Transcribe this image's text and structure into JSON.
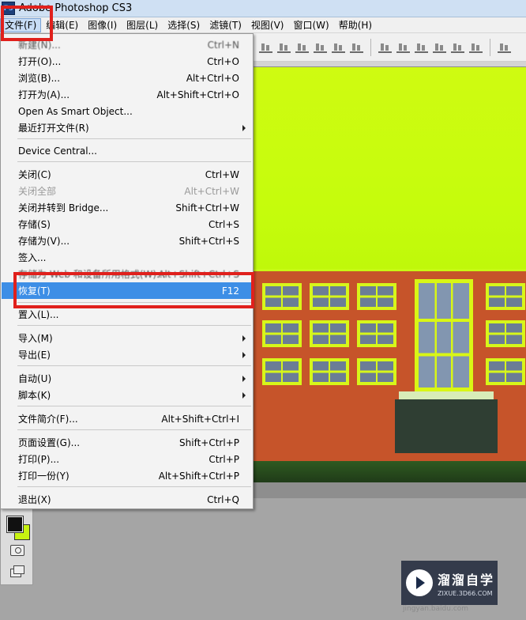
{
  "window": {
    "app_icon": "Ps",
    "title": "Adobe Photoshop CS3"
  },
  "menubar": [
    {
      "label": "文件(F)",
      "active": true
    },
    {
      "label": "编辑(E)"
    },
    {
      "label": "图像(I)"
    },
    {
      "label": "图层(L)"
    },
    {
      "label": "选择(S)"
    },
    {
      "label": "滤镜(T)"
    },
    {
      "label": "视图(V)"
    },
    {
      "label": "窗口(W)"
    },
    {
      "label": "帮助(H)"
    }
  ],
  "file_menu": {
    "items": [
      {
        "label": "新建(N)...",
        "shortcut": "Ctrl+N"
      },
      {
        "label": "打开(O)...",
        "shortcut": "Ctrl+O"
      },
      {
        "label": "浏览(B)...",
        "shortcut": "Alt+Ctrl+O"
      },
      {
        "label": "打开为(A)...",
        "shortcut": "Alt+Shift+Ctrl+O"
      },
      {
        "label": "Open As Smart Object...",
        "shortcut": ""
      },
      {
        "label": "最近打开文件(R)",
        "shortcut": "",
        "submenu": true
      },
      {
        "label": "Device Central...",
        "shortcut": ""
      },
      {
        "label": "关闭(C)",
        "shortcut": "Ctrl+W"
      },
      {
        "label": "关闭全部",
        "shortcut": "Alt+Ctrl+W",
        "disabled": true
      },
      {
        "label": "关闭并转到 Bridge...",
        "shortcut": "Shift+Ctrl+W"
      },
      {
        "label": "存储(S)",
        "shortcut": "Ctrl+S"
      },
      {
        "label": "存储为(V)...",
        "shortcut": "Shift+Ctrl+S"
      },
      {
        "label": "签入...",
        "shortcut": ""
      },
      {
        "label": "存储为 Web 和设备所用格式(W)...",
        "shortcut": "Alt+Shift+Ctrl+S"
      },
      {
        "label": "恢复(T)",
        "shortcut": "F12",
        "highlighted": true
      },
      {
        "label": "置入(L)...",
        "shortcut": ""
      },
      {
        "label": "导入(M)",
        "shortcut": "",
        "submenu": true
      },
      {
        "label": "导出(E)",
        "shortcut": "",
        "submenu": true
      },
      {
        "label": "自动(U)",
        "shortcut": "",
        "submenu": true
      },
      {
        "label": "脚本(K)",
        "shortcut": "",
        "submenu": true
      },
      {
        "label": "文件简介(F)...",
        "shortcut": "Alt+Shift+Ctrl+I"
      },
      {
        "label": "页面设置(G)...",
        "shortcut": "Shift+Ctrl+P"
      },
      {
        "label": "打印(P)...",
        "shortcut": "Ctrl+P"
      },
      {
        "label": "打印一份(Y)",
        "shortcut": "Alt+Shift+Ctrl+P"
      },
      {
        "label": "退出(X)",
        "shortcut": "Ctrl+Q"
      }
    ]
  },
  "toolbox": {
    "foreground_color": "#111111",
    "background_color": "#c8f311"
  },
  "watermark": {
    "title": "溜溜自学",
    "subtitle": "ZIXUE.3D66.COM",
    "footer": "jingyan.baidu.com"
  },
  "colors": {
    "highlight": "#3d8ee6",
    "annotation": "#e0201c",
    "canvas_sky": "#c9fb10"
  }
}
